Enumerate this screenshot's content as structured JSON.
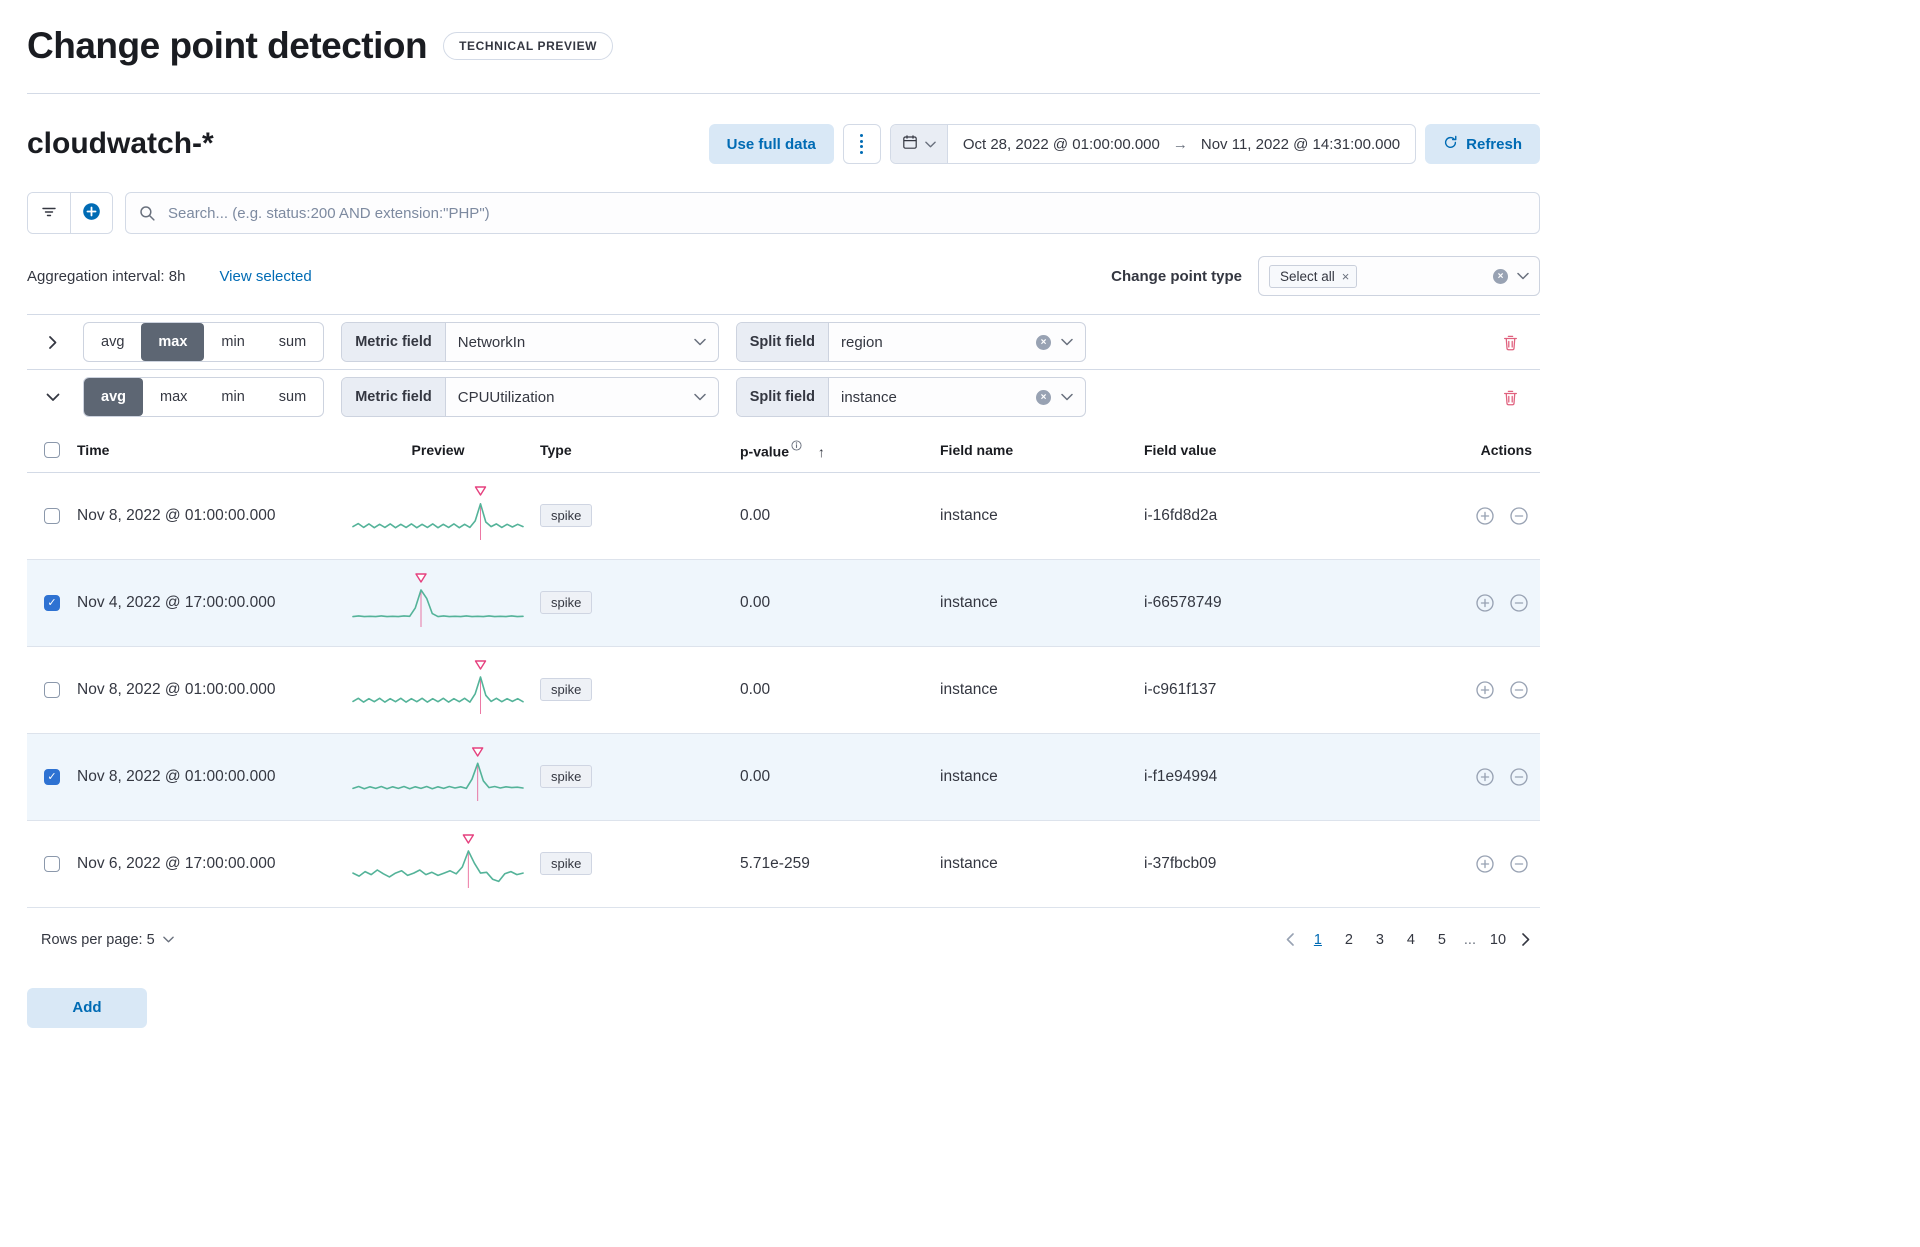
{
  "page": {
    "title": "Change point detection",
    "badge": "TECHNICAL PREVIEW"
  },
  "header": {
    "index_title": "cloudwatch-*",
    "use_full_data": "Use full data",
    "date_start": "Oct 28, 2022 @ 01:00:00.000",
    "date_end": "Nov 11, 2022 @ 14:31:00.000",
    "refresh": "Refresh"
  },
  "search": {
    "placeholder": "Search... (e.g. status:200 AND extension:\"PHP\")"
  },
  "controls": {
    "aggregation_label": "Aggregation interval: 8h",
    "view_selected": "View selected",
    "change_point_type_label": "Change point type",
    "select_all": "Select all"
  },
  "configs": [
    {
      "expanded": false,
      "functions": [
        "avg",
        "max",
        "min",
        "sum"
      ],
      "selected_function": "max",
      "metric_label": "Metric field",
      "metric_value": "NetworkIn",
      "split_label": "Split field",
      "split_value": "region"
    },
    {
      "expanded": true,
      "functions": [
        "avg",
        "max",
        "min",
        "sum"
      ],
      "selected_function": "avg",
      "metric_label": "Metric field",
      "metric_value": "CPUUtilization",
      "split_label": "Split field",
      "split_value": "instance"
    }
  ],
  "table": {
    "columns": [
      "Time",
      "Preview",
      "Type",
      "p-value",
      "Field name",
      "Field value",
      "Actions"
    ],
    "rows": [
      {
        "checked": false,
        "time": "Nov 8, 2022 @ 01:00:00.000",
        "type": "spike",
        "p_value": "0.00",
        "field_name": "instance",
        "field_value": "i-16fd8d2a",
        "sparkline": {
          "spike_index": 24,
          "points": [
            0.7,
            0.62,
            0.72,
            0.63,
            0.73,
            0.64,
            0.72,
            0.63,
            0.73,
            0.64,
            0.72,
            0.63,
            0.73,
            0.64,
            0.72,
            0.63,
            0.73,
            0.64,
            0.72,
            0.63,
            0.73,
            0.64,
            0.72,
            0.55,
            0.1,
            0.58,
            0.7,
            0.63,
            0.72,
            0.64,
            0.71,
            0.64,
            0.7
          ]
        }
      },
      {
        "checked": true,
        "time": "Nov 4, 2022 @ 17:00:00.000",
        "type": "spike",
        "p_value": "0.00",
        "field_name": "instance",
        "field_value": "i-66578749",
        "sparkline": {
          "spike_index": 12,
          "points": [
            0.78,
            0.76,
            0.78,
            0.77,
            0.78,
            0.76,
            0.78,
            0.77,
            0.78,
            0.76,
            0.77,
            0.55,
            0.08,
            0.3,
            0.7,
            0.78,
            0.76,
            0.78,
            0.77,
            0.78,
            0.76,
            0.78,
            0.77,
            0.78,
            0.76,
            0.78,
            0.77,
            0.78,
            0.76,
            0.78,
            0.77
          ]
        }
      },
      {
        "checked": false,
        "time": "Nov 8, 2022 @ 01:00:00.000",
        "type": "spike",
        "p_value": "0.00",
        "field_name": "instance",
        "field_value": "i-c961f137",
        "sparkline": {
          "spike_index": 24,
          "points": [
            0.72,
            0.64,
            0.74,
            0.65,
            0.73,
            0.64,
            0.74,
            0.65,
            0.73,
            0.64,
            0.74,
            0.65,
            0.73,
            0.64,
            0.74,
            0.65,
            0.73,
            0.64,
            0.74,
            0.65,
            0.73,
            0.64,
            0.74,
            0.52,
            0.08,
            0.56,
            0.72,
            0.64,
            0.73,
            0.65,
            0.72,
            0.65,
            0.73
          ]
        }
      },
      {
        "checked": true,
        "time": "Nov 8, 2022 @ 01:00:00.000",
        "type": "spike",
        "p_value": "0.00",
        "field_name": "instance",
        "field_value": "i-f1e94994",
        "sparkline": {
          "spike_index": 22,
          "points": [
            0.72,
            0.67,
            0.73,
            0.68,
            0.72,
            0.67,
            0.73,
            0.68,
            0.72,
            0.67,
            0.73,
            0.68,
            0.72,
            0.67,
            0.73,
            0.68,
            0.72,
            0.67,
            0.71,
            0.68,
            0.72,
            0.48,
            0.06,
            0.52,
            0.7,
            0.67,
            0.71,
            0.68,
            0.7,
            0.69,
            0.71
          ]
        }
      },
      {
        "checked": false,
        "time": "Nov 6, 2022 @ 17:00:00.000",
        "type": "spike",
        "p_value": "5.71e-259",
        "field_name": "instance",
        "field_value": "i-37fbcb09",
        "sparkline": {
          "spike_index": 19,
          "points": [
            0.66,
            0.74,
            0.62,
            0.7,
            0.58,
            0.68,
            0.76,
            0.66,
            0.6,
            0.72,
            0.66,
            0.58,
            0.7,
            0.64,
            0.72,
            0.66,
            0.6,
            0.68,
            0.5,
            0.08,
            0.4,
            0.66,
            0.64,
            0.82,
            0.88,
            0.68,
            0.62,
            0.7,
            0.66
          ]
        }
      }
    ]
  },
  "pagination": {
    "rows_per_page": "Rows per page: 5",
    "pages": [
      "1",
      "2",
      "3",
      "4",
      "5",
      "...",
      "10"
    ],
    "active_page": "1"
  },
  "footer": {
    "add": "Add"
  },
  "colors": {
    "primary": "#006bb4",
    "primary_light_bg": "#d9e8f6",
    "accent_pink": "#e5407e",
    "sparkline_green": "#54b399",
    "selected_row_bg": "#eff6fc",
    "border": "#d3dae6",
    "text": "#343741",
    "danger": "#e0617e",
    "checkbox": "#2e72d2"
  }
}
